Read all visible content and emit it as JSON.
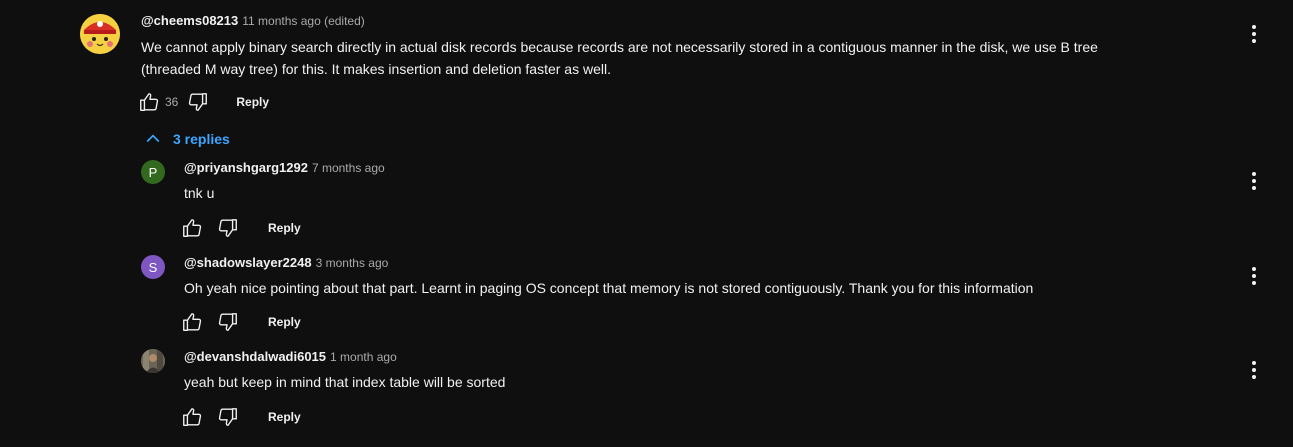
{
  "comment": {
    "author": "@cheems08213",
    "time": "11 months ago (edited)",
    "text_line1": "We cannot apply binary search directly in actual disk records because records are not necessarily stored in a contiguous manner in the disk, we use B tree",
    "text_line2": "(threaded M way tree) for this. It makes insertion and deletion faster as well.",
    "likes": "36",
    "reply_label": "Reply"
  },
  "replies_toggle": {
    "label": "3 replies"
  },
  "replies": [
    {
      "author": "@priyanshgarg1292",
      "time": "7 months ago",
      "text": "tnk u",
      "avatar_letter": "P",
      "avatar_color": "#33691e",
      "reply_label": "Reply"
    },
    {
      "author": "@shadowslayer2248",
      "time": "3 months ago",
      "text": "Oh yeah nice pointing about that part. Learnt in paging OS concept that memory is not stored contiguously. Thank you for this information",
      "avatar_letter": "S",
      "avatar_color": "#7e57c2",
      "reply_label": "Reply"
    },
    {
      "author": "@devanshdalwadi6015",
      "time": "1 month ago",
      "text": "yeah but keep in mind that index table will be sorted",
      "reply_label": "Reply"
    }
  ],
  "icons": {
    "like": "thumbs-up-icon",
    "dislike": "thumbs-down-icon",
    "more": "kebab-menu-icon",
    "chevron": "chevron-up-icon"
  },
  "colors": {
    "background": "#0f0f0f",
    "link_blue": "#3ea6ff",
    "secondary_text": "#aaaaaa"
  }
}
